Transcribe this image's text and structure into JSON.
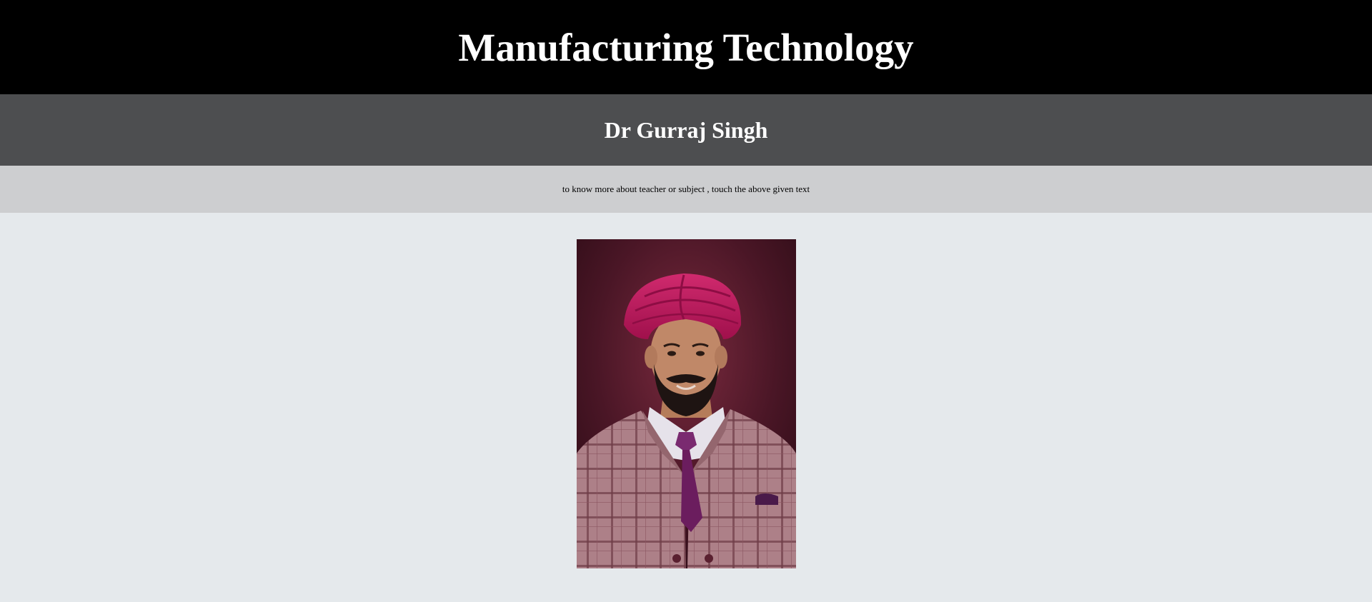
{
  "header": {
    "title": "Manufacturing Technology"
  },
  "teacher": {
    "name": "Dr Gurraj Singh"
  },
  "hint": {
    "text": "to know more about teacher or subject , touch the above given text"
  },
  "photo": {
    "alt": "Dr Gurraj Singh"
  },
  "colors": {
    "header_bg": "#000000",
    "teacher_bar_bg": "#4d4e50",
    "hint_bar_bg": "#cdced0",
    "page_bg": "#e5e9ec",
    "turban": "#c0185e",
    "suit": "#a87a80",
    "tie": "#6b1d5e"
  }
}
